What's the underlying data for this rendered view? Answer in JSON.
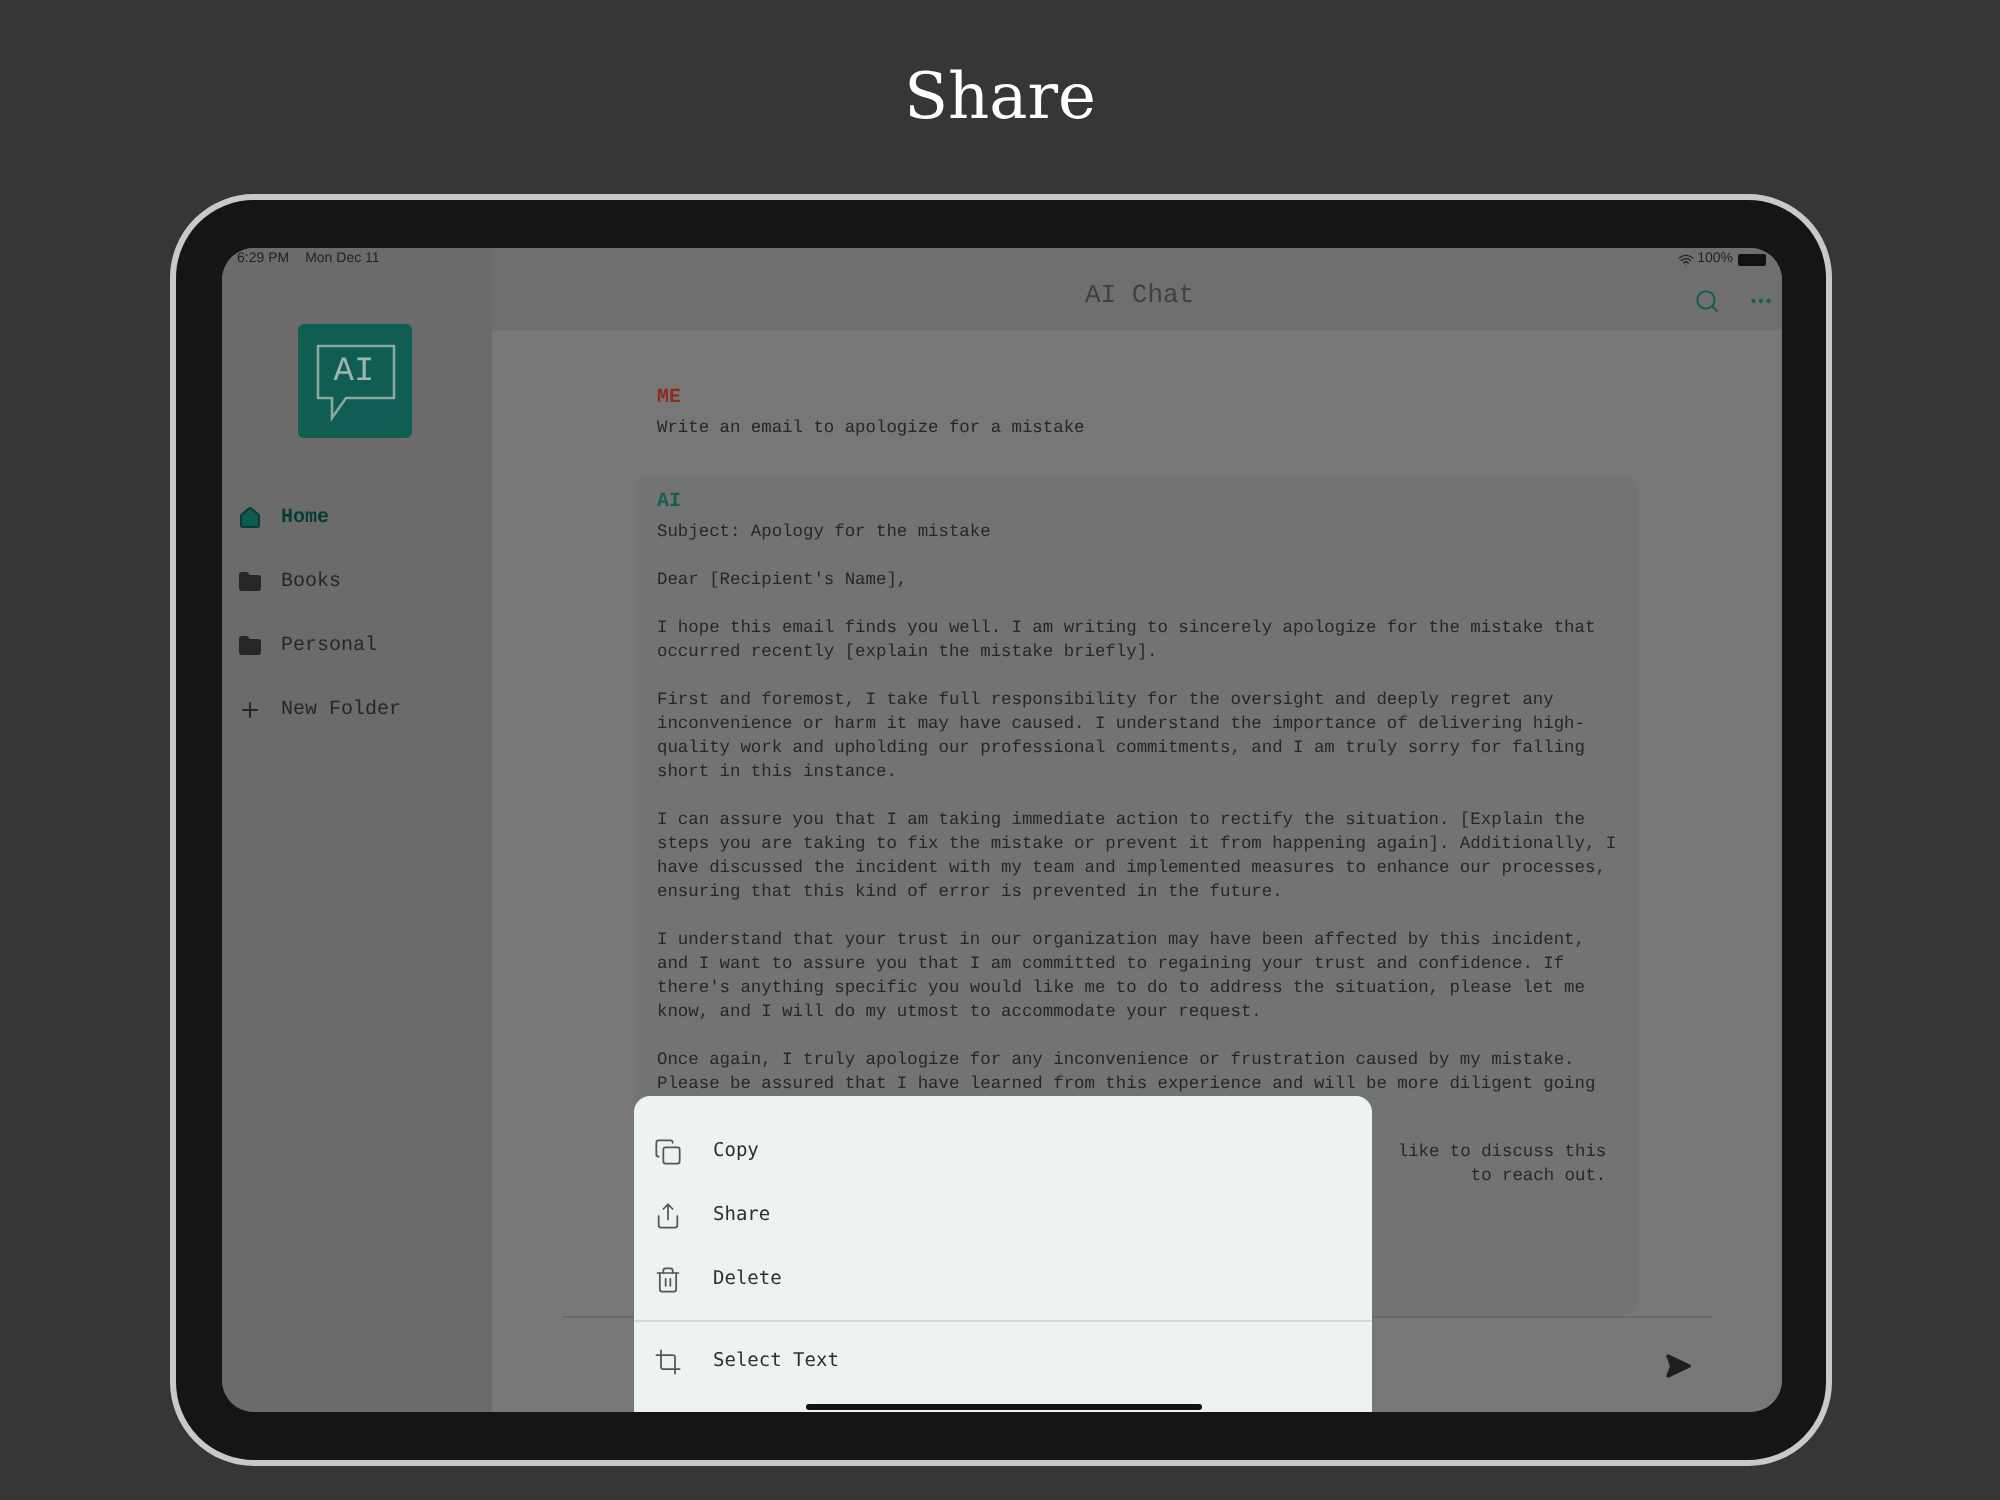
{
  "caption": "Share",
  "status_bar": {
    "time": "6:29 PM",
    "date": "Mon Dec 11",
    "battery": "100%"
  },
  "sidebar": {
    "logo": "AI",
    "items": [
      {
        "label": "Home",
        "kind": "folder",
        "selected": true
      },
      {
        "label": "Books",
        "kind": "folder",
        "selected": false
      },
      {
        "label": "Personal",
        "kind": "folder",
        "selected": false
      },
      {
        "label": "New Folder",
        "kind": "add",
        "selected": false
      }
    ]
  },
  "header": {
    "title": "AI Chat"
  },
  "messages": [
    {
      "author": "ME",
      "kind": "user",
      "paragraphs": [
        {
          "lines": [
            "Write an email to apologize for a mistake"
          ]
        }
      ]
    },
    {
      "author": "AI",
      "kind": "ai",
      "paragraphs": [
        {
          "lines": [
            "Subject: Apology for the mistake"
          ]
        },
        {
          "lines": [
            "Dear [Recipient's Name],"
          ]
        },
        {
          "lines": [
            "I hope this email finds you well. I am writing to sincerely apologize for the mistake that",
            "occurred recently [explain the mistake briefly]."
          ]
        },
        {
          "lines": [
            "First and foremost, I take full responsibility for the oversight and deeply regret any",
            "inconvenience or harm it may have caused. I understand the importance of delivering high-",
            "quality work and upholding our professional commitments, and I am truly sorry for falling",
            "short in this instance."
          ]
        },
        {
          "lines": [
            "I can assure you that I am taking immediate action to rectify the situation. [Explain the",
            "steps you are taking to fix the mistake or prevent it from happening again]. Additionally, I",
            "have discussed the incident with my team and implemented measures to enhance our processes,",
            "ensuring that this kind of error is prevented in the future."
          ]
        },
        {
          "lines": [
            "I understand that your trust in our organization may have been affected by this incident,",
            "and I want to assure you that I am committed to regaining your trust and confidence. If",
            "there's anything specific you would like me to do to address the situation, please let me",
            "know, and I will do my utmost to accommodate your request."
          ]
        },
        {
          "lines": [
            "Once again, I truly apologize for any inconvenience or frustration caused by my mistake.",
            "Please be assured that I have learned from this experience and will be more diligent going"
          ]
        },
        {
          "lines": [
            "like to discuss this",
            "to reach out."
          ],
          "kind": "partial"
        }
      ]
    }
  ],
  "menu": [
    {
      "label": "Copy",
      "kind": "copy"
    },
    {
      "label": "Share",
      "kind": "share"
    },
    {
      "label": "Delete",
      "kind": "delete"
    },
    {
      "label": "Select Text",
      "kind": "select"
    }
  ]
}
